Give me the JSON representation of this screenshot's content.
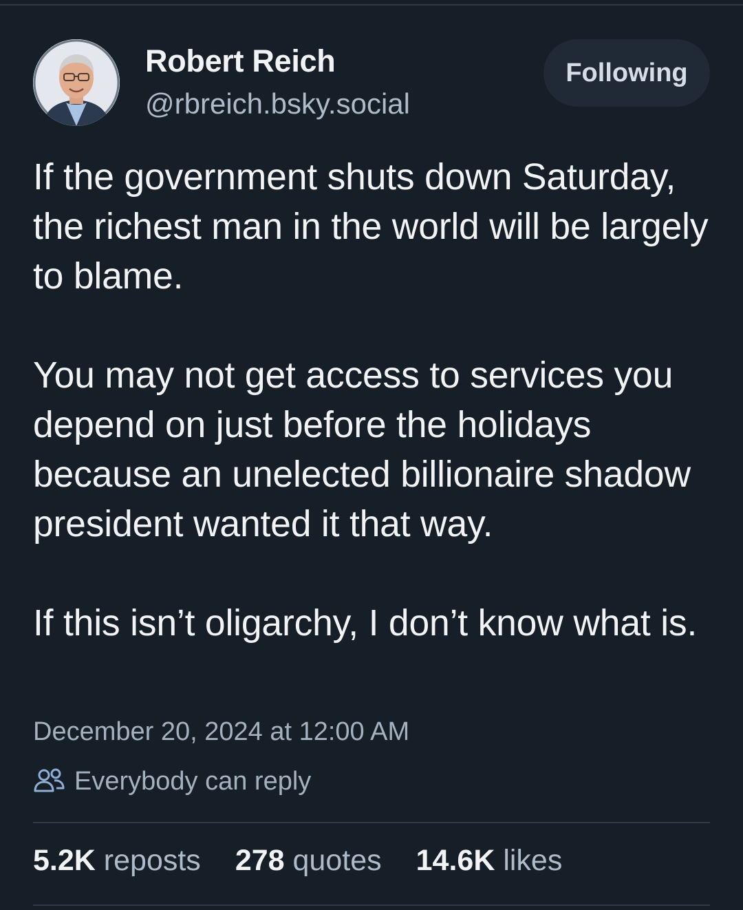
{
  "author": {
    "display_name": "Robert Reich",
    "handle": "@rbreich.bsky.social"
  },
  "follow_button": {
    "label": "Following"
  },
  "post": {
    "paragraphs": [
      "If the government shuts down Saturday, the richest man in the world will be largely to blame.",
      "You may not get access to services you depend on just before the holidays because an unelected billionaire shadow president wanted it that way.",
      "If this isn’t oligarchy, I don’t know what is."
    ],
    "timestamp": "December 20, 2024 at 12:00 AM",
    "reply_setting": "Everybody can reply",
    "reply_setting_icon": "people-icon"
  },
  "stats": {
    "reposts": {
      "count": "5.2K",
      "label": "reposts"
    },
    "quotes": {
      "count": "278",
      "label": "quotes"
    },
    "likes": {
      "count": "14.6K",
      "label": "likes"
    }
  },
  "colors": {
    "background": "#161e27",
    "text_primary": "#f1f3f5",
    "text_secondary": "#a4b1bf",
    "button_bg": "#1f2a36",
    "divider": "#2e3a48"
  }
}
